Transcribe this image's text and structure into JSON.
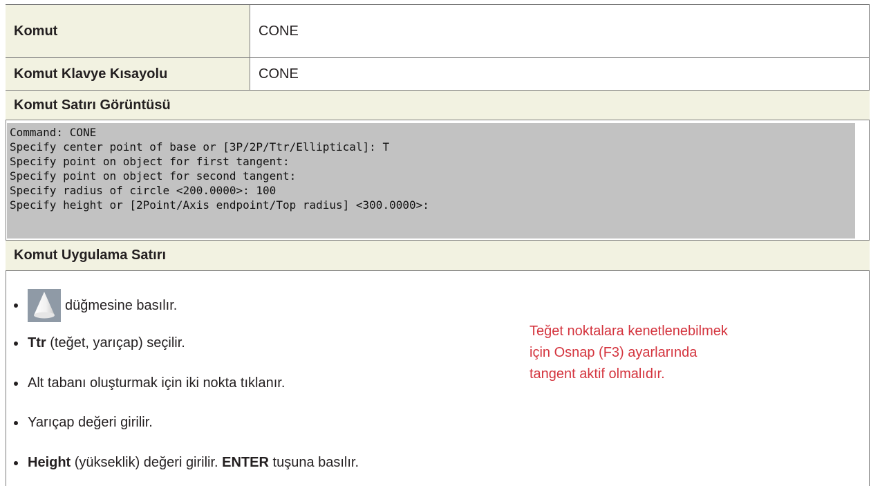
{
  "rows": [
    {
      "label": "Komut",
      "value": "CONE"
    },
    {
      "label": "Komut Klavye Kısayolu",
      "value": "CONE"
    }
  ],
  "console_section": {
    "title": "Komut Satırı Görüntüsü",
    "lines": [
      "Command: CONE",
      "Specify center point of base or [3P/2P/Ttr/Elliptical]: T",
      "Specify point on object for first tangent:",
      "Specify point on object for second tangent:",
      "Specify radius of circle <200.0000>: 100",
      "Specify height or [2Point/Axis endpoint/Top radius] <300.0000>:"
    ]
  },
  "steps_section": {
    "title": "Komut Uygulama Satırı",
    "step1": {
      "icon": "cone-icon",
      "text": "düğmesine basılır."
    },
    "step2": {
      "bold": "Ttr",
      "text": " (teğet, yarıçap) seçilir."
    },
    "step3": {
      "text": "Alt tabanı oluşturmak için iki nokta tıklanır."
    },
    "step4": {
      "text": "Yarıçap değeri girilir."
    },
    "step5": {
      "bold1": "Height",
      "text1": " (yükseklik) değeri girilir. ",
      "bold2": "ENTER",
      "text2": " tuşuna basılır."
    }
  },
  "note": "Teğet noktalara kenetlenebilmek için Osnap (F3) ayarlarında tangent aktif olmalıdır.",
  "colors": {
    "header_bg": "#f2f2e1",
    "console_bg": "#c2c2c2",
    "note": "#d4343e"
  }
}
